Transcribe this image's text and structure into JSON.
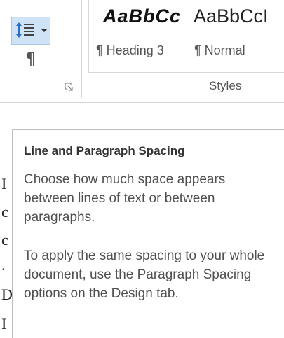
{
  "ribbon": {
    "paragraph_mark": "¶",
    "styles": [
      {
        "preview": "AaBbCc",
        "name": "¶ Heading 3"
      },
      {
        "preview": "AaBbCcI",
        "name": "¶ Normal"
      }
    ],
    "styles_group_label": "Styles",
    "line_spacing_icon": "line-paragraph-spacing-icon"
  },
  "tooltip": {
    "title": "Line and Paragraph Spacing",
    "paragraph1": "Choose how much space appears between lines of text or between paragraphs.",
    "paragraph2": "To apply the same spacing to your whole document, use the Paragraph Spacing options on the Design tab."
  },
  "document_edge": {
    "glyphs": [
      "I",
      "c",
      "c",
      ".",
      "D",
      "I"
    ]
  },
  "colors": {
    "selected_button_bg": "#cfe3f6",
    "selected_button_border": "#a7c8eb",
    "tooltip_title": "#333333",
    "tooltip_body": "#505050"
  }
}
